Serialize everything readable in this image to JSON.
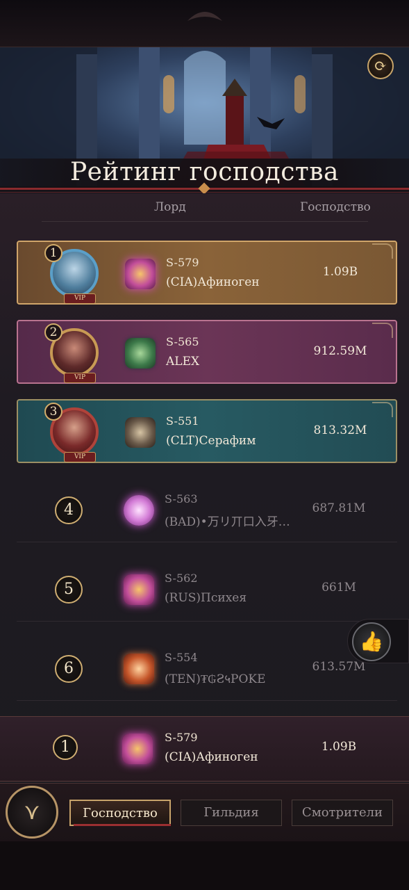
{
  "header": {
    "title": "Рейтинг господства",
    "refresh_icon": "refresh-icon"
  },
  "columns": {
    "lord": "Лорд",
    "dominance": "Господство"
  },
  "rows": [
    {
      "rank": "1",
      "server": "S-579",
      "name": "(CIA)Афиноген",
      "score": "1.09B",
      "vip": "VIP",
      "emblem": "flower-crest-icon"
    },
    {
      "rank": "2",
      "server": "S-565",
      "name": "ALEX",
      "score": "912.59M",
      "vip": "VIP",
      "emblem": "mask-crest-icon"
    },
    {
      "rank": "3",
      "server": "S-551",
      "name": "(CLT)Серафим",
      "score": "813.32M",
      "vip": "VIP",
      "emblem": "crown-crest-icon"
    },
    {
      "rank": "4",
      "server": "S-563",
      "name": "(BAD)•万リ丌口入牙…",
      "score": "687.81M",
      "emblem": "heart-crest-icon"
    },
    {
      "rank": "5",
      "server": "S-562",
      "name": "(RUS)Психея",
      "score": "661M",
      "emblem": "flower-crest-icon"
    },
    {
      "rank": "6",
      "server": "S-554",
      "name": "(TEN)₮₲Ƨ५ΡΟΚΕ",
      "score": "613.57M",
      "emblem": "skull-crest-icon"
    }
  ],
  "own_row": {
    "rank": "1",
    "server": "S-579",
    "name": "(CIA)Афиноген",
    "score": "1.09B",
    "emblem": "flower-crest-icon"
  },
  "like_icon": "thumbs-up-icon",
  "tabs": [
    {
      "label": "Господство",
      "active": true
    },
    {
      "label": "Гильдия",
      "active": false
    },
    {
      "label": "Смотрители",
      "active": false
    }
  ],
  "menu_icon": "menu-emblem-icon"
}
